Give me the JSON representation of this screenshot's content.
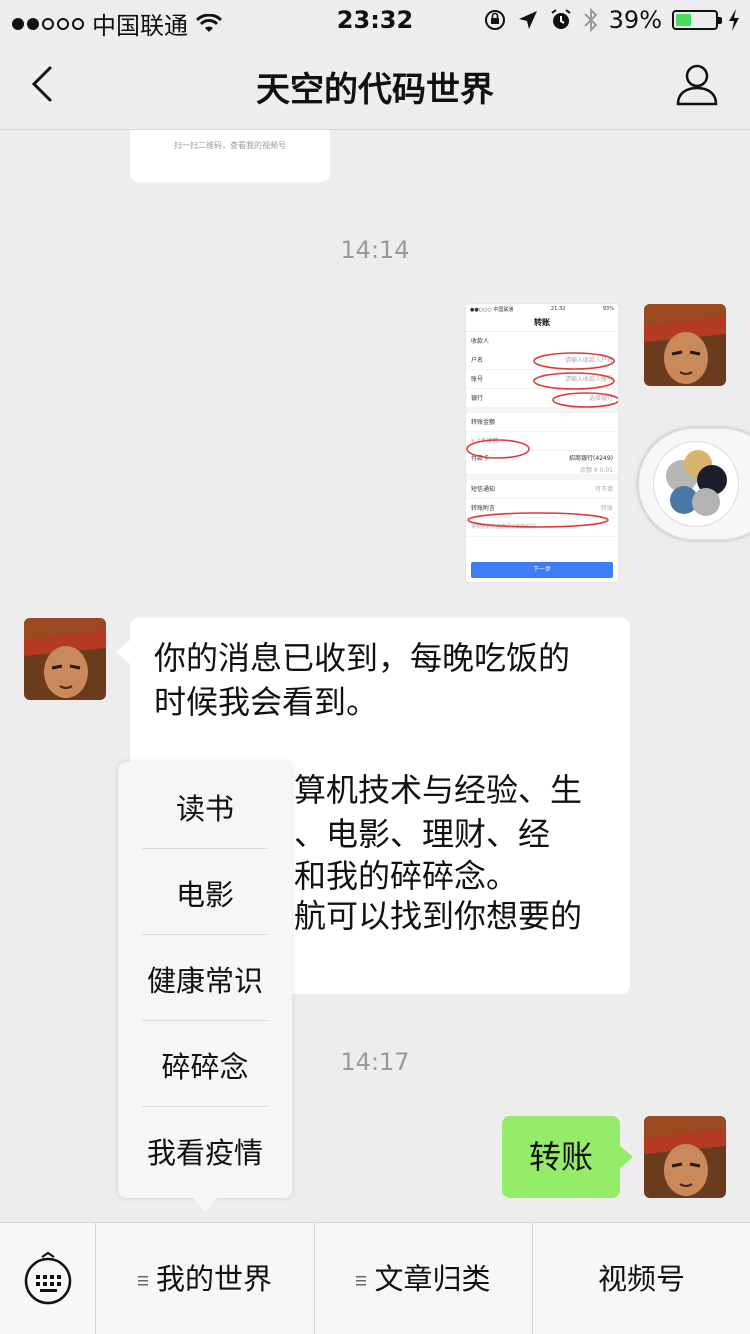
{
  "status_bar": {
    "carrier": "中国联通",
    "time": "23:32",
    "battery": "39%",
    "battery_level": 0.39,
    "icons": [
      "wifi-icon",
      "orientation-lock-icon",
      "location-icon",
      "alarm-icon",
      "bluetooth-icon",
      "battery-icon"
    ]
  },
  "nav": {
    "title": "天空的代码世界",
    "back_icon": "chevron-left-icon",
    "profile_icon": "person-icon"
  },
  "chat": {
    "card_caption": "扫一扫二维码，查看我的视频号",
    "timestamp_1": "14:14",
    "timestamp_2": "14:17",
    "screenshot": {
      "status_left": "●●○○○ 中国联通",
      "status_time": "21:32",
      "status_right": "93%",
      "title": "转账",
      "section_payee": "收款人",
      "name_label": "户名",
      "name_hint": "请输入收款人户名",
      "account_label": "账号",
      "account_hint": "请输入收款人账号",
      "bank_label": "银行",
      "bank_hint": "选择银行",
      "amount_label": "转账金额",
      "amount_hint": "¥ 0手续费",
      "card_label": "付款卡",
      "card_value": "招商银行(4249)",
      "balance": "余额 ¥ 0.01",
      "sms_label": "短信通知",
      "sms_value": "可不填",
      "note_label": "转账附言",
      "note_value": "转账",
      "footer_hint": "将根据转账信息预计到账时间",
      "button": "下一步"
    },
    "received_message": {
      "line1": "你的消息已收到，每晚吃饭的",
      "line2": "时候我会看到。",
      "line3": "算机技术与经验、生",
      "line4": "、电影、理财、经",
      "line5": "和我的碎碎念。",
      "line6": "航可以找到你想要的"
    },
    "sent_message": "转账"
  },
  "popup_menu": {
    "items": [
      "读书",
      "电影",
      "健康常识",
      "碎碎念",
      "我看疫情"
    ]
  },
  "bottom_menu": {
    "keyboard_icon": "keyboard-icon",
    "items": [
      "我的世界",
      "文章归类",
      "视频号"
    ]
  },
  "colors": {
    "background": "#ededed",
    "sent_bubble": "#95ec69",
    "received_bubble": "#ffffff",
    "battery_fill": "#4cd964",
    "screenshot_button": "#3d7df5",
    "annotation_red": "#e0393b"
  }
}
